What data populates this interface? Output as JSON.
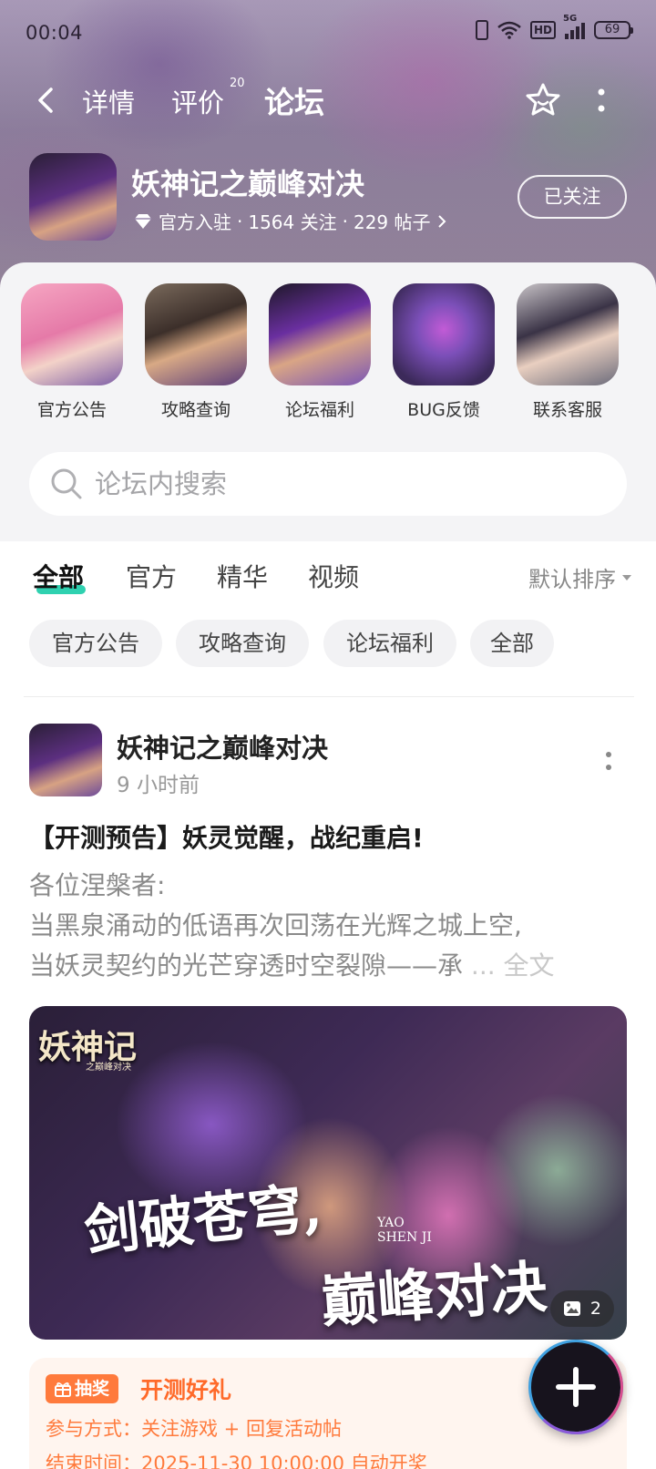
{
  "status_bar": {
    "time": "00:04",
    "network": "5G",
    "hd": "HD",
    "battery": "69"
  },
  "nav": {
    "tabs": [
      {
        "label": "详情"
      },
      {
        "label": "评价",
        "badge": "20"
      },
      {
        "label": "论坛",
        "active": true
      }
    ]
  },
  "game": {
    "title": "妖神记之巅峰对决",
    "official": "官方入驻",
    "followers": "1564 关注",
    "posts": "229 帖子",
    "follow_label": "已关注"
  },
  "shortcuts": [
    {
      "label": "官方公告"
    },
    {
      "label": "攻略查询"
    },
    {
      "label": "论坛福利"
    },
    {
      "label": "BUG反馈"
    },
    {
      "label": "联系客服"
    }
  ],
  "search": {
    "placeholder": "论坛内搜索"
  },
  "category_tabs": [
    {
      "label": "全部",
      "active": true
    },
    {
      "label": "官方"
    },
    {
      "label": "精华"
    },
    {
      "label": "视频"
    }
  ],
  "sort_label": "默认排序",
  "chips": [
    {
      "label": "官方公告"
    },
    {
      "label": "攻略查询"
    },
    {
      "label": "论坛福利"
    },
    {
      "label": "全部"
    }
  ],
  "post": {
    "author": "妖神记之巅峰对决",
    "time": "9 小时前",
    "title": "【开测预告】妖灵觉醒，战纪重启!",
    "body_lines": [
      "各位涅槃者:",
      "当黑泉涌动的低语再次回荡在光辉之城上空,",
      "当妖灵契约的光芒穿透时空裂隙——承"
    ],
    "ellipsis": "... ",
    "fulltext_label": "全文",
    "image": {
      "logo": "妖神记",
      "logo_sub": "之巅峰对决",
      "slogan_1": "剑破苍穹,",
      "slogan_2": "巅峰对决",
      "english_1": "YAO",
      "english_2": "SHEN JI",
      "count": "2"
    }
  },
  "lottery": {
    "tag": "抽奖",
    "title": "开测好礼",
    "join_method": "参与方式：关注游戏 + 回复活动帖",
    "end_time": "结束时间：2025-11-30 10:00:00 自动开奖"
  },
  "colors": {
    "accent": "#2fd1b0",
    "lottery_orange": "#ff7a3c",
    "fab_bg": "#17131d"
  }
}
